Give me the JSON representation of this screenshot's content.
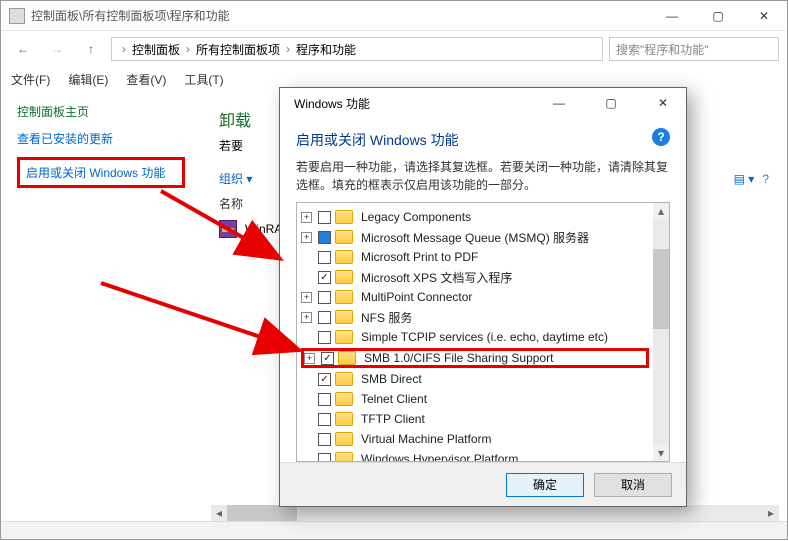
{
  "main": {
    "title_path": "控制面板\\所有控制面板项\\程序和功能",
    "breadcrumb": [
      "控制面板",
      "所有控制面板项",
      "程序和功能"
    ],
    "search_placeholder": "搜索\"程序和功能\"",
    "menubar": [
      "文件(F)",
      "编辑(E)",
      "查看(V)",
      "工具(T)"
    ],
    "sidebar": {
      "heading": "控制面板主页",
      "links": [
        "查看已安装的更新",
        "启用或关闭 Windows 功能"
      ]
    },
    "content": {
      "heading": "卸载",
      "hint_prefix": "若要",
      "organize": "组织 ▾",
      "column": "名称",
      "item": "WinRAR"
    }
  },
  "dialog": {
    "window_title": "Windows 功能",
    "heading": "启用或关闭 Windows 功能",
    "description": "若要启用一种功能，请选择其复选框。若要关闭一种功能，请清除其复选框。填充的框表示仅启用该功能的一部分。",
    "buttons": {
      "ok": "确定",
      "cancel": "取消"
    },
    "features": [
      {
        "exp": "+",
        "cb": "empty",
        "label": "Legacy Components"
      },
      {
        "exp": "+",
        "cb": "filled",
        "label": "Microsoft Message Queue (MSMQ) 服务器"
      },
      {
        "exp": "",
        "cb": "empty",
        "label": "Microsoft Print to PDF"
      },
      {
        "exp": "",
        "cb": "check",
        "label": "Microsoft XPS 文档写入程序"
      },
      {
        "exp": "+",
        "cb": "empty",
        "label": "MultiPoint Connector"
      },
      {
        "exp": "+",
        "cb": "empty",
        "label": "NFS 服务"
      },
      {
        "exp": "",
        "cb": "empty",
        "label": "Simple TCPIP services (i.e. echo, daytime etc)"
      },
      {
        "exp": "+",
        "cb": "check",
        "label": "SMB 1.0/CIFS File Sharing Support",
        "highlight": true
      },
      {
        "exp": "",
        "cb": "check",
        "label": "SMB Direct"
      },
      {
        "exp": "",
        "cb": "empty",
        "label": "Telnet Client"
      },
      {
        "exp": "",
        "cb": "empty",
        "label": "TFTP Client"
      },
      {
        "exp": "",
        "cb": "empty",
        "label": "Virtual Machine Platform"
      },
      {
        "exp": "",
        "cb": "empty",
        "label": "Windows Hypervisor Platform"
      }
    ]
  }
}
